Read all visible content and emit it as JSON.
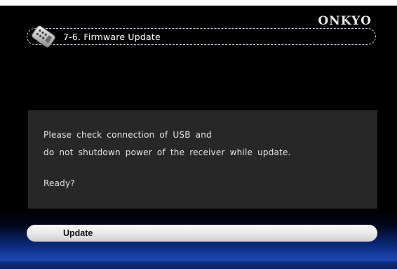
{
  "brand": {
    "logo_text": "ONKYO"
  },
  "header": {
    "title": "7-6. Firmware Update",
    "icon": "remote-control-icon"
  },
  "message": {
    "line1": "Please check connection of USB and",
    "line2": "do not shutdown power of the receiver while update.",
    "line3": "Ready?"
  },
  "actions": {
    "update_label": "Update"
  },
  "colors": {
    "background": "#000000",
    "panel": "#272727",
    "title_border": "#c7d4ea",
    "accent_blue": "#1c48b4",
    "button": "#e9e9e9"
  }
}
